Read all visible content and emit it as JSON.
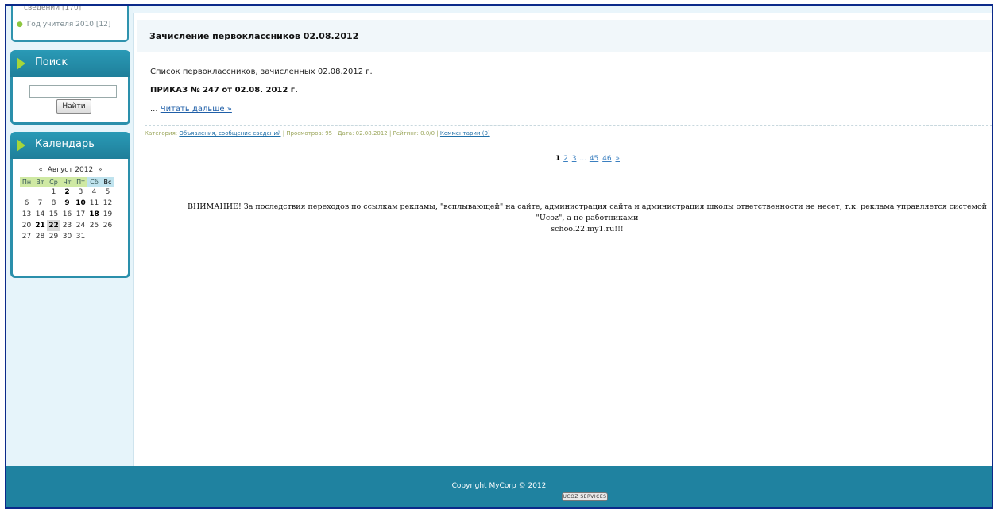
{
  "sidebar": {
    "categories": {
      "cut_text": "сведений [170]",
      "item": "Год учителя 2010 [12]"
    },
    "search": {
      "title": "Поиск",
      "input_value": "",
      "button_label": "Найти"
    },
    "calendar": {
      "title": "Календарь",
      "prev": "«",
      "next": "»",
      "month": "Август 2012",
      "weekdays": [
        "Пн",
        "Вт",
        "Ср",
        "Чт",
        "Пт",
        "Сб",
        "Вс"
      ],
      "weeks": [
        [
          "",
          "",
          "1",
          "2",
          "3",
          "4",
          "5"
        ],
        [
          "6",
          "7",
          "8",
          "9",
          "10",
          "11",
          "12"
        ],
        [
          "13",
          "14",
          "15",
          "16",
          "17",
          "18",
          "19"
        ],
        [
          "20",
          "21",
          "22",
          "23",
          "24",
          "25",
          "26"
        ],
        [
          "27",
          "28",
          "29",
          "30",
          "31",
          "",
          ""
        ]
      ],
      "bold_days": [
        "2",
        "9",
        "10",
        "18",
        "21",
        "22"
      ],
      "today": "22"
    }
  },
  "post": {
    "title": "Зачисление первоклассников 02.08.2012",
    "intro": "Список первоклассников, зачисленных 02.08.2012 г.",
    "order": "ПРИКАЗ № 247 от 02.08. 2012 г.",
    "more_prefix": "...",
    "more_link": "Читать дальше »",
    "meta": {
      "category_label": "Категория:",
      "category_value": "Объявления, сообщение сведений",
      "views": "Просмотров: 95",
      "date": "Дата: 02.08.2012",
      "rating": "Рейтинг: 0.0/0",
      "comments": "Комментарии (0)",
      "separator": "|"
    }
  },
  "pager": {
    "current": "1",
    "pages": [
      "2",
      "3"
    ],
    "ellipsis": "...",
    "tail": [
      "45",
      "46"
    ],
    "next": "»"
  },
  "warning": {
    "line1": "ВНИМАНИЕ! За последствия переходов по ссылкам рекламы, \"всплывающей\" на сайте, администрация сайта и администрация школы ответственности не несет, т.к. реклама управляется системой \"Ucoz\", а не работниками",
    "line2": "school22.my1.ru!!!"
  },
  "footer": {
    "copyright": "Copyright MyCorp © 2012",
    "badge": "UCOZ SERVICES"
  },
  "colors": {
    "frame": "#0b2a8a",
    "sidebar_head": "#2a9ab6",
    "footer": "#1f82a0",
    "arrow": "#a6d63a"
  }
}
